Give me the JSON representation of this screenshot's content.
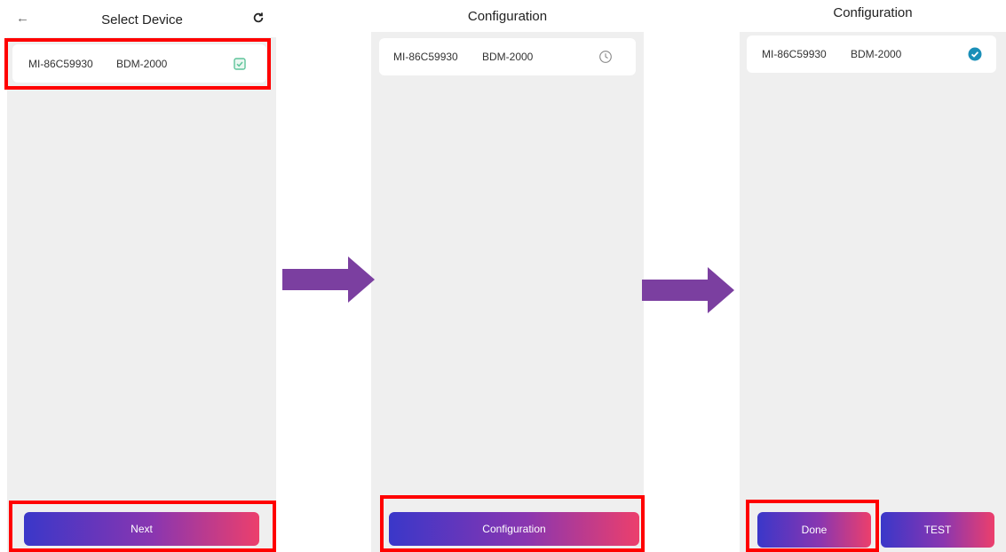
{
  "screen1": {
    "back_glyph": "←",
    "title": "Select Device",
    "device": {
      "id": "MI-86C59930",
      "model": "BDM-2000"
    },
    "next_label": "Next"
  },
  "screen2": {
    "title": "Configuration",
    "device": {
      "id": "MI-86C59930",
      "model": "BDM-2000"
    },
    "configuration_label": "Configuration"
  },
  "screen3": {
    "title": "Configuration",
    "device": {
      "id": "MI-86C59930",
      "model": "BDM-2000"
    },
    "done_label": "Done",
    "test_label": "TEST"
  },
  "colors": {
    "highlight": "#ff0000",
    "arrow": "#7b3fa0",
    "checkbox": "#5ec49a",
    "success": "#1a8fb8",
    "gradient_start": "#3a37c9",
    "gradient_end": "#ec3f6c"
  }
}
